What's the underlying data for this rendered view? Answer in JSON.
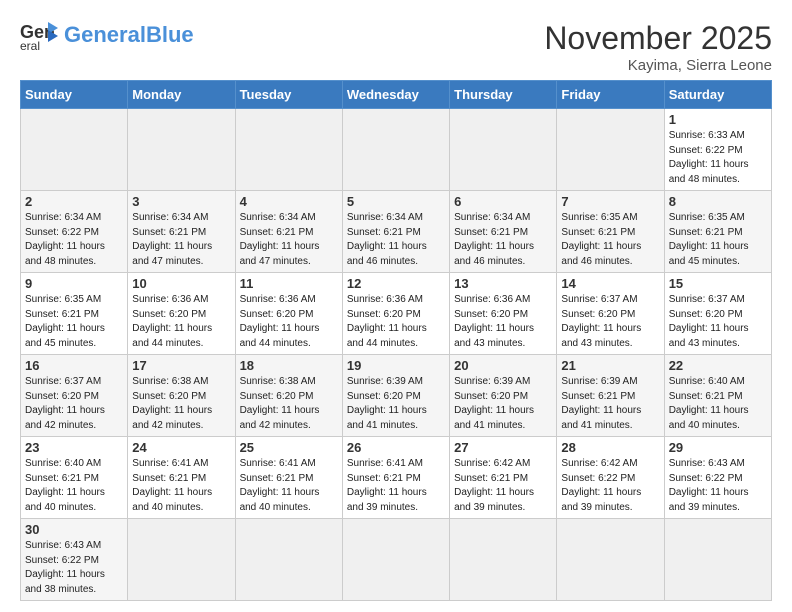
{
  "header": {
    "logo_general": "General",
    "logo_blue": "Blue",
    "month_title": "November 2025",
    "location": "Kayima, Sierra Leone"
  },
  "weekdays": [
    "Sunday",
    "Monday",
    "Tuesday",
    "Wednesday",
    "Thursday",
    "Friday",
    "Saturday"
  ],
  "weeks": [
    [
      {
        "day": "",
        "info": "",
        "empty": true
      },
      {
        "day": "",
        "info": "",
        "empty": true
      },
      {
        "day": "",
        "info": "",
        "empty": true
      },
      {
        "day": "",
        "info": "",
        "empty": true
      },
      {
        "day": "",
        "info": "",
        "empty": true
      },
      {
        "day": "",
        "info": "",
        "empty": true
      },
      {
        "day": "1",
        "info": "Sunrise: 6:33 AM\nSunset: 6:22 PM\nDaylight: 11 hours\nand 48 minutes."
      }
    ],
    [
      {
        "day": "2",
        "info": "Sunrise: 6:34 AM\nSunset: 6:22 PM\nDaylight: 11 hours\nand 48 minutes."
      },
      {
        "day": "3",
        "info": "Sunrise: 6:34 AM\nSunset: 6:21 PM\nDaylight: 11 hours\nand 47 minutes."
      },
      {
        "day": "4",
        "info": "Sunrise: 6:34 AM\nSunset: 6:21 PM\nDaylight: 11 hours\nand 47 minutes."
      },
      {
        "day": "5",
        "info": "Sunrise: 6:34 AM\nSunset: 6:21 PM\nDaylight: 11 hours\nand 46 minutes."
      },
      {
        "day": "6",
        "info": "Sunrise: 6:34 AM\nSunset: 6:21 PM\nDaylight: 11 hours\nand 46 minutes."
      },
      {
        "day": "7",
        "info": "Sunrise: 6:35 AM\nSunset: 6:21 PM\nDaylight: 11 hours\nand 46 minutes."
      },
      {
        "day": "8",
        "info": "Sunrise: 6:35 AM\nSunset: 6:21 PM\nDaylight: 11 hours\nand 45 minutes."
      }
    ],
    [
      {
        "day": "9",
        "info": "Sunrise: 6:35 AM\nSunset: 6:21 PM\nDaylight: 11 hours\nand 45 minutes."
      },
      {
        "day": "10",
        "info": "Sunrise: 6:36 AM\nSunset: 6:20 PM\nDaylight: 11 hours\nand 44 minutes."
      },
      {
        "day": "11",
        "info": "Sunrise: 6:36 AM\nSunset: 6:20 PM\nDaylight: 11 hours\nand 44 minutes."
      },
      {
        "day": "12",
        "info": "Sunrise: 6:36 AM\nSunset: 6:20 PM\nDaylight: 11 hours\nand 44 minutes."
      },
      {
        "day": "13",
        "info": "Sunrise: 6:36 AM\nSunset: 6:20 PM\nDaylight: 11 hours\nand 43 minutes."
      },
      {
        "day": "14",
        "info": "Sunrise: 6:37 AM\nSunset: 6:20 PM\nDaylight: 11 hours\nand 43 minutes."
      },
      {
        "day": "15",
        "info": "Sunrise: 6:37 AM\nSunset: 6:20 PM\nDaylight: 11 hours\nand 43 minutes."
      }
    ],
    [
      {
        "day": "16",
        "info": "Sunrise: 6:37 AM\nSunset: 6:20 PM\nDaylight: 11 hours\nand 42 minutes."
      },
      {
        "day": "17",
        "info": "Sunrise: 6:38 AM\nSunset: 6:20 PM\nDaylight: 11 hours\nand 42 minutes."
      },
      {
        "day": "18",
        "info": "Sunrise: 6:38 AM\nSunset: 6:20 PM\nDaylight: 11 hours\nand 42 minutes."
      },
      {
        "day": "19",
        "info": "Sunrise: 6:39 AM\nSunset: 6:20 PM\nDaylight: 11 hours\nand 41 minutes."
      },
      {
        "day": "20",
        "info": "Sunrise: 6:39 AM\nSunset: 6:20 PM\nDaylight: 11 hours\nand 41 minutes."
      },
      {
        "day": "21",
        "info": "Sunrise: 6:39 AM\nSunset: 6:21 PM\nDaylight: 11 hours\nand 41 minutes."
      },
      {
        "day": "22",
        "info": "Sunrise: 6:40 AM\nSunset: 6:21 PM\nDaylight: 11 hours\nand 40 minutes."
      }
    ],
    [
      {
        "day": "23",
        "info": "Sunrise: 6:40 AM\nSunset: 6:21 PM\nDaylight: 11 hours\nand 40 minutes."
      },
      {
        "day": "24",
        "info": "Sunrise: 6:41 AM\nSunset: 6:21 PM\nDaylight: 11 hours\nand 40 minutes."
      },
      {
        "day": "25",
        "info": "Sunrise: 6:41 AM\nSunset: 6:21 PM\nDaylight: 11 hours\nand 40 minutes."
      },
      {
        "day": "26",
        "info": "Sunrise: 6:41 AM\nSunset: 6:21 PM\nDaylight: 11 hours\nand 39 minutes."
      },
      {
        "day": "27",
        "info": "Sunrise: 6:42 AM\nSunset: 6:21 PM\nDaylight: 11 hours\nand 39 minutes."
      },
      {
        "day": "28",
        "info": "Sunrise: 6:42 AM\nSunset: 6:22 PM\nDaylight: 11 hours\nand 39 minutes."
      },
      {
        "day": "29",
        "info": "Sunrise: 6:43 AM\nSunset: 6:22 PM\nDaylight: 11 hours\nand 39 minutes."
      }
    ],
    [
      {
        "day": "30",
        "info": "Sunrise: 6:43 AM\nSunset: 6:22 PM\nDaylight: 11 hours\nand 38 minutes."
      },
      {
        "day": "",
        "info": "",
        "empty": true
      },
      {
        "day": "",
        "info": "",
        "empty": true
      },
      {
        "day": "",
        "info": "",
        "empty": true
      },
      {
        "day": "",
        "info": "",
        "empty": true
      },
      {
        "day": "",
        "info": "",
        "empty": true
      },
      {
        "day": "",
        "info": "",
        "empty": true
      }
    ]
  ]
}
